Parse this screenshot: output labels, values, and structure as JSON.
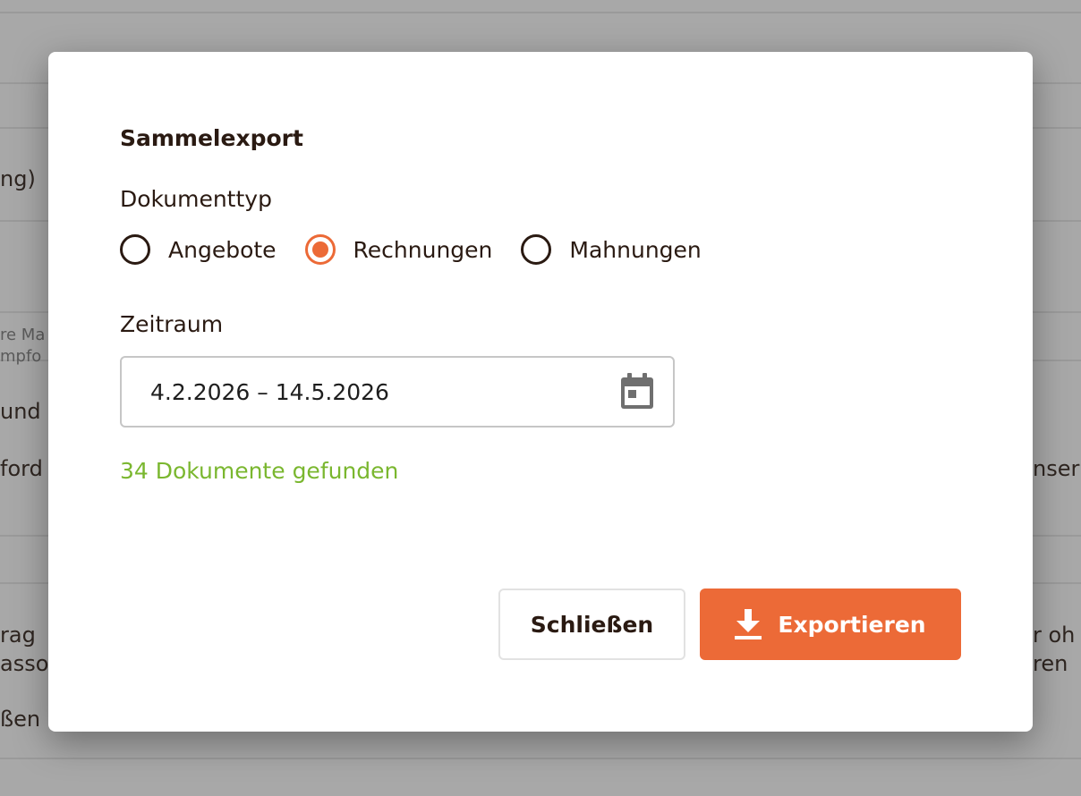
{
  "background": {
    "fragments": [
      "ng)",
      "re Ma",
      "mpfo",
      "und",
      "ford",
      "nser",
      "rag",
      "asso",
      "r oh",
      "ren",
      "ßen"
    ]
  },
  "modal": {
    "title": "Sammelexport",
    "doctype_label": "Dokumenttyp",
    "doctype_options": [
      {
        "label": "Angebote",
        "checked": false
      },
      {
        "label": "Rechnungen",
        "checked": true
      },
      {
        "label": "Mahnungen",
        "checked": false
      }
    ],
    "period_label": "Zeitraum",
    "period_value": "4.2.2026 – 14.5.2026",
    "result_text": "34 Dokumente gefunden",
    "close_label": "Schließen",
    "export_label": "Exportieren"
  },
  "colors": {
    "accent": "#ec6a37",
    "success": "#7ab72f",
    "text": "#2a1a12"
  },
  "icons": {
    "calendar": "calendar-icon",
    "download": "download-icon"
  }
}
